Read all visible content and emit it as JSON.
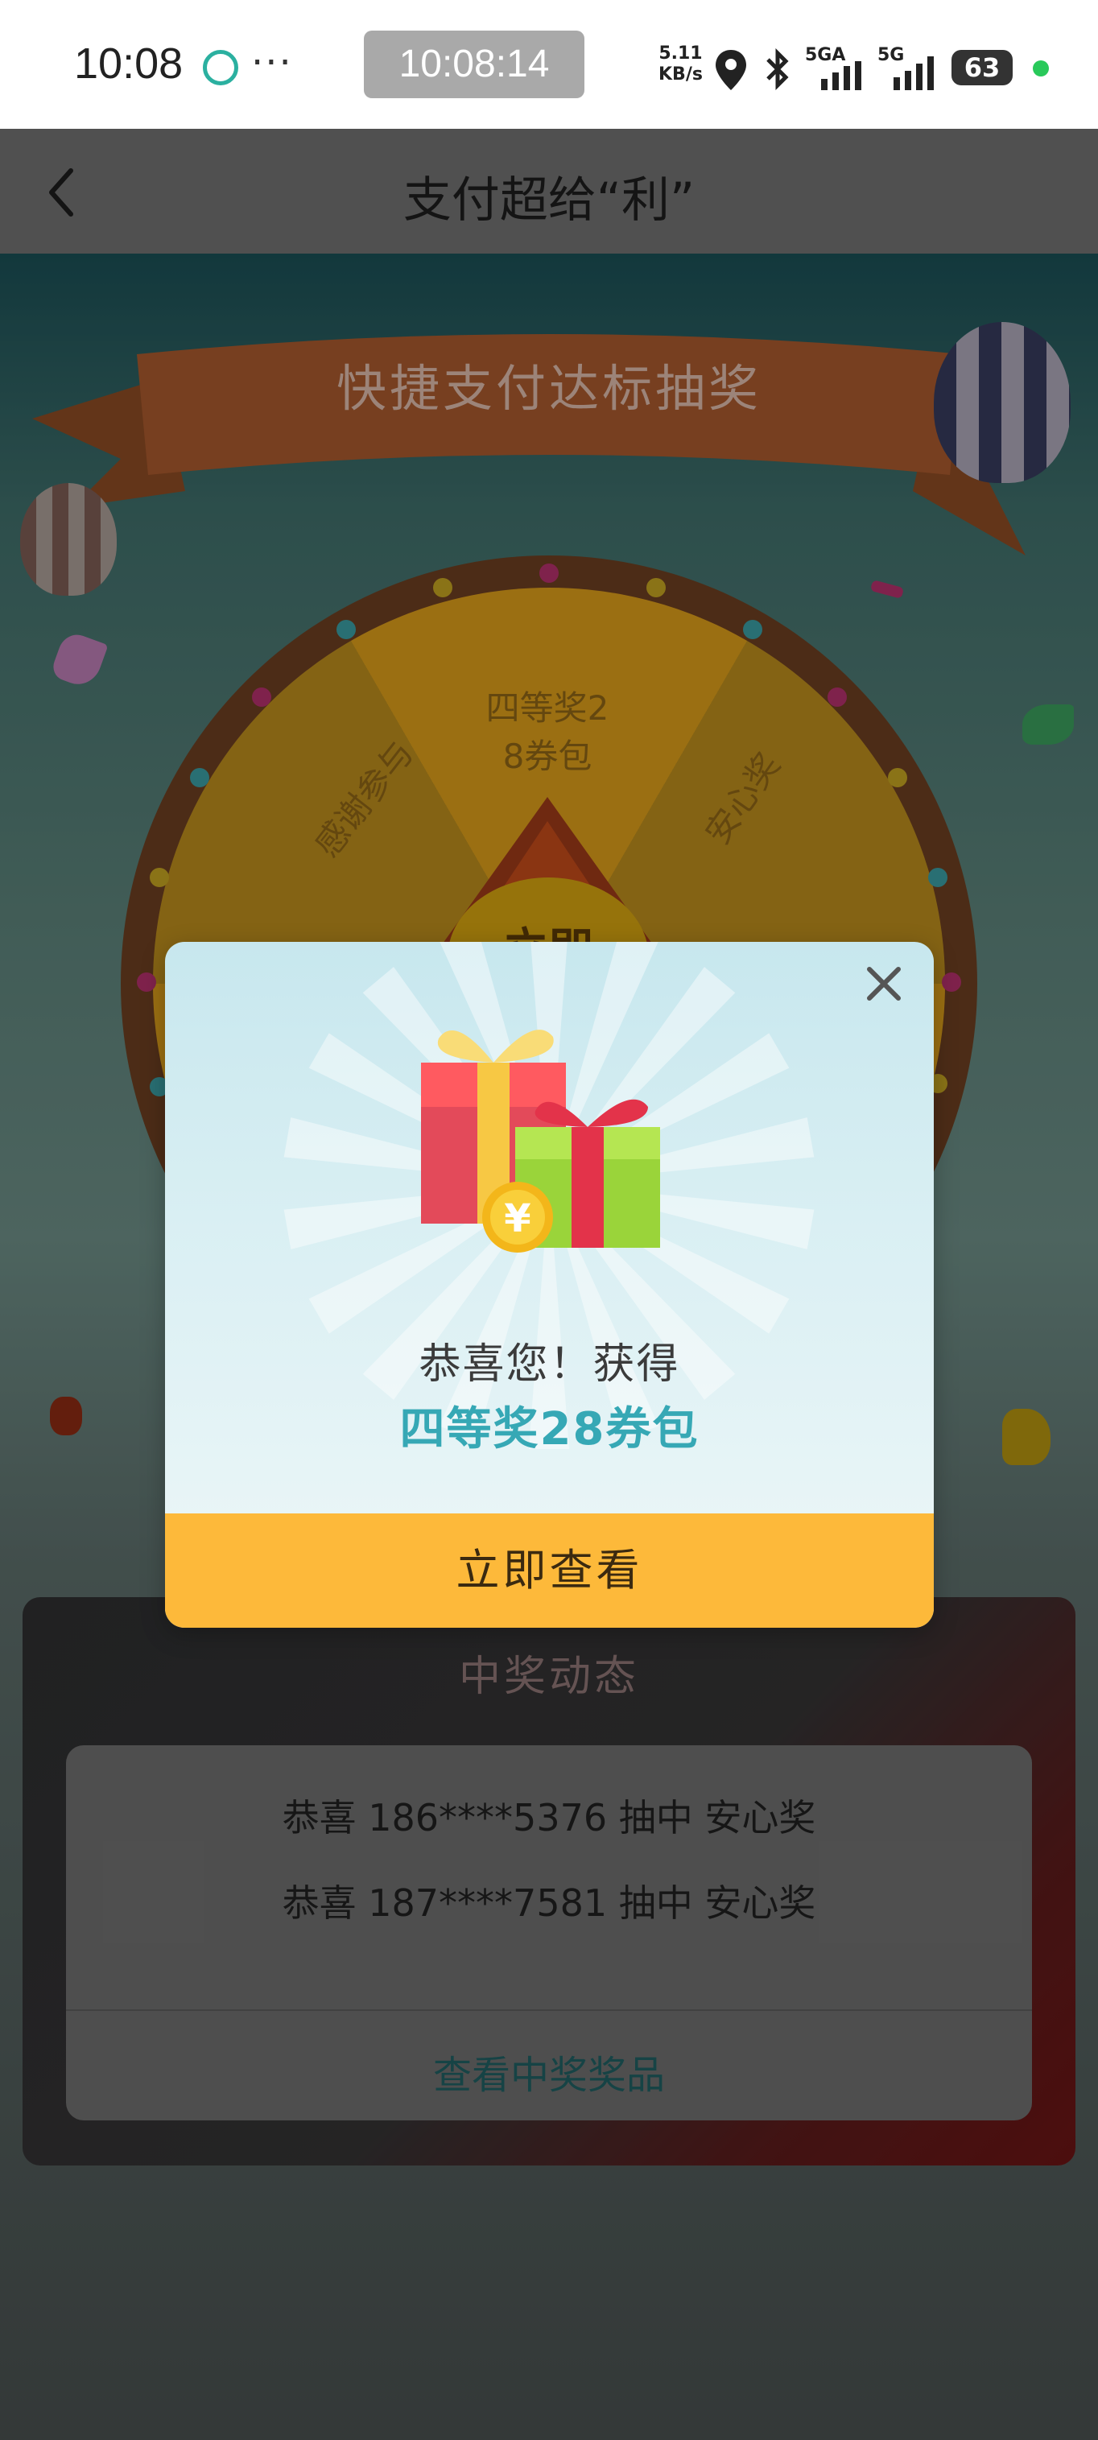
{
  "status_bar": {
    "time": "10:08",
    "dots": "···",
    "clock": "10:08:14",
    "net_speed_value": "5.11",
    "net_speed_unit": "KB/s",
    "signal1_label": "5GA",
    "signal2_label": "5G",
    "battery": "63",
    "icons": [
      "app-notification-icon",
      "location-icon",
      "bluetooth-icon",
      "signal-icon",
      "signal-icon",
      "battery-icon",
      "charging-dot-icon"
    ]
  },
  "header": {
    "title": "支付超给“利”",
    "back_icon": "chevron-left-icon"
  },
  "game": {
    "banner": "快捷支付达标抽奖",
    "wheel_labels": [
      "四等奖2\n8券包",
      "安心奖",
      "感谢参与"
    ],
    "wheel_center": "立即"
  },
  "modal": {
    "close_icon": "close-icon",
    "gift_icon": "gift-icon",
    "congrats": "恭喜您！获得",
    "prize": "四等奖28券包",
    "button": "立即查看"
  },
  "winners": {
    "title": "中奖动态",
    "rows": [
      "恭喜 186****5376 抽中 安心奖",
      "恭喜 187****7581 抽中 安心奖"
    ],
    "link": "查看中奖奖品"
  },
  "colors": {
    "accent_button": "#fdb93a",
    "prize_text": "#36a8b5",
    "header_bg": "#6f6f6f"
  }
}
